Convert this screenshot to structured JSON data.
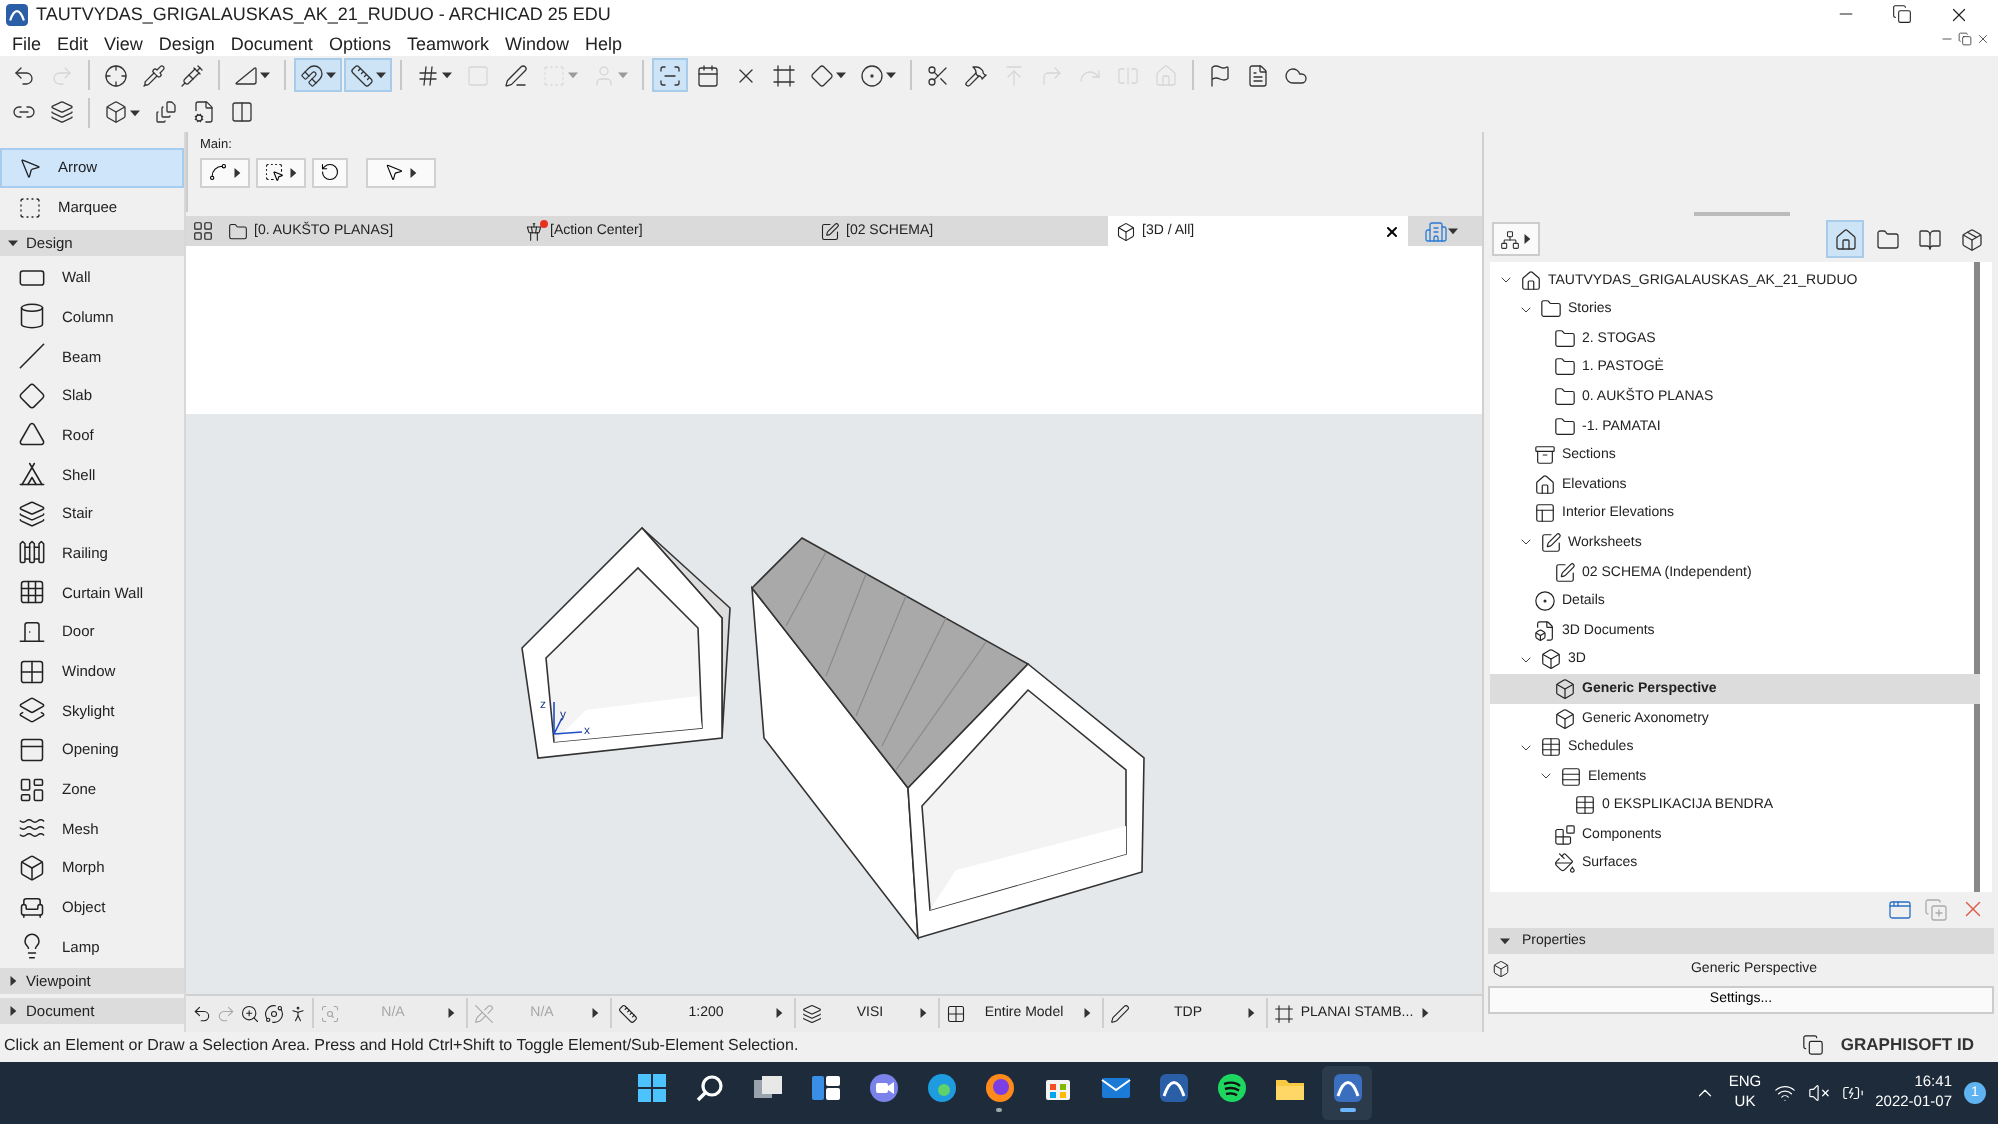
{
  "window": {
    "title": "TAUTVYDAS_GRIGALAUSKAS_AK_21_RUDUO - ARCHICAD 25 EDU"
  },
  "menu": [
    "File",
    "Edit",
    "View",
    "Design",
    "Document",
    "Options",
    "Teamwork",
    "Window",
    "Help"
  ],
  "toolbar": [
    {
      "selected": false,
      "disabled": false
    },
    {
      "selected": false,
      "disabled": true
    },
    {
      "selected": false,
      "disabled": false
    },
    {
      "selected": false,
      "disabled": false
    },
    {
      "selected": false,
      "disabled": false
    },
    {
      "selected": false,
      "disabled": false
    },
    {
      "selected": true,
      "disabled": false
    },
    {
      "selected": true,
      "disabled": false
    },
    {
      "selected": false,
      "disabled": false
    },
    {
      "selected": false,
      "disabled": true
    },
    {
      "selected": false,
      "disabled": false
    },
    {
      "selected": false,
      "disabled": true
    },
    {
      "selected": false,
      "disabled": true
    },
    {
      "selected": true,
      "disabled": false
    },
    {
      "selected": false,
      "disabled": false
    },
    {
      "selected": false,
      "disabled": false
    },
    {
      "selected": false,
      "disabled": false
    },
    {
      "selected": false,
      "disabled": false
    },
    {
      "selected": false,
      "disabled": false
    },
    {
      "selected": false,
      "disabled": false
    },
    {
      "selected": false,
      "disabled": false
    },
    {
      "selected": false,
      "disabled": true
    },
    {
      "selected": false,
      "disabled": true
    },
    {
      "selected": false,
      "disabled": true
    },
    {
      "selected": false,
      "disabled": true
    },
    {
      "selected": false,
      "disabled": true
    },
    {
      "selected": false,
      "disabled": false
    },
    {
      "selected": false,
      "disabled": false
    },
    {
      "selected": false,
      "disabled": false
    }
  ],
  "toolbox": {
    "tools": [
      {
        "label": "Arrow",
        "selected": true
      },
      {
        "label": "Marquee",
        "selected": false
      }
    ],
    "sections": [
      {
        "label": "Design",
        "expanded": true,
        "items": [
          {
            "label": "Wall",
            "selected": false
          },
          {
            "label": "Column",
            "selected": false
          },
          {
            "label": "Beam",
            "selected": false
          },
          {
            "label": "Slab",
            "selected": false
          },
          {
            "label": "Roof",
            "selected": false
          },
          {
            "label": "Shell",
            "selected": false
          },
          {
            "label": "Stair",
            "selected": false
          },
          {
            "label": "Railing",
            "selected": false
          },
          {
            "label": "Curtain Wall",
            "selected": false
          },
          {
            "label": "Door",
            "selected": false
          },
          {
            "label": "Window",
            "selected": false
          },
          {
            "label": "Skylight",
            "selected": false
          },
          {
            "label": "Opening",
            "selected": false
          },
          {
            "label": "Zone",
            "selected": false
          },
          {
            "label": "Mesh",
            "selected": false
          },
          {
            "label": "Morph",
            "selected": false
          },
          {
            "label": "Object",
            "selected": false
          },
          {
            "label": "Lamp",
            "selected": false
          }
        ]
      },
      {
        "label": "Viewpoint",
        "expanded": false
      },
      {
        "label": "Document",
        "expanded": false
      }
    ]
  },
  "info_box": {
    "label": "Main:"
  },
  "tabs": [
    {
      "kind": "story",
      "label": "[0. AUKŠTO PLANAS]",
      "selected": false,
      "alert": false
    },
    {
      "kind": "action",
      "label": "[Action Center]",
      "selected": false,
      "alert": true
    },
    {
      "kind": "worksheet",
      "label": "[02 SCHEMA]",
      "selected": false,
      "alert": false
    },
    {
      "kind": "view3d",
      "label": "[3D / All]",
      "selected": true,
      "alert": false
    }
  ],
  "viewport": {
    "axis_labels": [
      "z",
      "y",
      "x"
    ]
  },
  "view_bar": [
    {
      "value": "N/A",
      "disabled": true
    },
    {
      "value": "N/A",
      "disabled": true
    },
    {
      "value": "1:200",
      "disabled": false
    },
    {
      "value": "VISI",
      "disabled": false
    },
    {
      "value": "Entire Model",
      "disabled": false
    },
    {
      "value": "TDP",
      "disabled": false
    },
    {
      "value": "PLANAI STAMB...",
      "disabled": false
    }
  ],
  "navigator": {
    "view_modes": [
      {
        "selected": true
      },
      {
        "selected": false
      },
      {
        "selected": false
      },
      {
        "selected": false
      }
    ],
    "tree": [
      {
        "kind": "project",
        "label": "TAUTVYDAS_GRIGALAUSKAS_AK_21_RUDUO",
        "expanded": true,
        "selected": false,
        "children": [
          {
            "kind": "story",
            "label": "Stories",
            "expanded": true,
            "selected": false,
            "children": [
              {
                "kind": "story",
                "label": "2. STOGAS",
                "selected": false
              },
              {
                "kind": "story",
                "label": "1. PASTOGĖ",
                "selected": false
              },
              {
                "kind": "story",
                "label": "0. AUKŠTO PLANAS",
                "selected": false
              },
              {
                "kind": "story",
                "label": "-1. PAMATAI",
                "selected": false
              }
            ]
          },
          {
            "kind": "section",
            "label": "Sections",
            "selected": false
          },
          {
            "kind": "elevation",
            "label": "Elevations",
            "selected": false
          },
          {
            "kind": "interior",
            "label": "Interior Elevations",
            "selected": false
          },
          {
            "kind": "worksheet",
            "label": "Worksheets",
            "expanded": true,
            "selected": false,
            "children": [
              {
                "kind": "worksheet",
                "label": "02 SCHEMA (Independent)",
                "selected": false
              }
            ]
          },
          {
            "kind": "detail",
            "label": "Details",
            "selected": false
          },
          {
            "kind": "document",
            "label": "3D Documents",
            "selected": false
          },
          {
            "kind": "view3d",
            "label": "3D",
            "expanded": true,
            "selected": false,
            "children": [
              {
                "kind": "view3d",
                "label": "Generic Perspective",
                "selected": true
              },
              {
                "kind": "view3d",
                "label": "Generic Axonometry",
                "selected": false
              }
            ]
          },
          {
            "kind": "table",
            "label": "Schedules",
            "expanded": true,
            "selected": false,
            "children": [
              {
                "kind": "elements",
                "label": "Elements",
                "expanded": true,
                "selected": false,
                "children": [
                  {
                    "kind": "table",
                    "label": "0 EKSPLIKACIJA BENDRA",
                    "selected": false
                  }
                ]
              },
              {
                "kind": "components",
                "label": "Components",
                "selected": false
              },
              {
                "kind": "surfaces",
                "label": "Surfaces",
                "selected": false
              }
            ]
          }
        ]
      }
    ],
    "properties": {
      "title": "Properties",
      "expanded": true,
      "name": "Generic Perspective",
      "button": "Settings..."
    }
  },
  "status_bar": {
    "message": "Click an Element or Draw a Selection Area. Press and Hold Ctrl+Shift to Toggle Element/Sub-Element Selection.",
    "account": "GRAPHISOFT ID"
  },
  "taskbar": {
    "apps": [
      {
        "running": false,
        "active": false
      },
      {
        "running": false,
        "active": false
      },
      {
        "running": false,
        "active": false
      },
      {
        "running": false,
        "active": false
      },
      {
        "running": false,
        "active": false
      },
      {
        "running": false,
        "active": false
      },
      {
        "running": true,
        "active": false
      },
      {
        "running": false,
        "active": false
      },
      {
        "running": false,
        "active": false
      },
      {
        "running": false,
        "active": false
      },
      {
        "running": false,
        "active": false
      },
      {
        "running": false,
        "active": false
      },
      {
        "running": true,
        "active": true
      }
    ],
    "language": "ENG",
    "region": "UK",
    "time": "16:41",
    "date": "2022-01-07",
    "notifications": "1"
  }
}
